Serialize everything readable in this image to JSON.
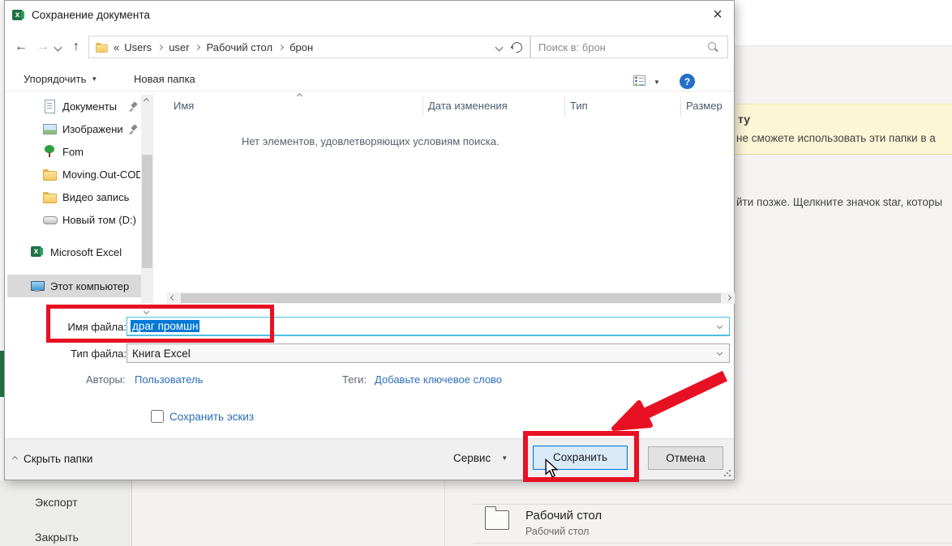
{
  "colors": {
    "annotation_red": "#e81123",
    "accent_blue": "#0078d7",
    "selection_blue": "#0078d7",
    "banner_bg": "#fcf5d6",
    "excel_green": "#217346"
  },
  "dialog": {
    "title": "Сохранение документа",
    "close_glyph": "×",
    "nav": {
      "back_glyph": "←",
      "forward_glyph": "→",
      "up_glyph": "↑",
      "breadcrumb_root": "«",
      "crumbs": [
        "Users",
        "user",
        "Рабочий стол",
        "брон"
      ],
      "search_placeholder": "Поиск в: брон"
    },
    "toolbar": {
      "organize": "Упорядочить",
      "new_folder": "Новая папка",
      "caret_glyph": "▼",
      "help_glyph": "?"
    },
    "sidebar": {
      "items": [
        {
          "label": "Документы",
          "icon": "document",
          "pinned": true,
          "level": 1,
          "selected": false
        },
        {
          "label": "Изображени",
          "icon": "image",
          "pinned": true,
          "level": 1,
          "selected": false
        },
        {
          "label": "Fom",
          "icon": "tree",
          "pinned": false,
          "level": 1,
          "selected": false
        },
        {
          "label": "Moving.Out-COD",
          "icon": "folder",
          "pinned": false,
          "level": 1,
          "selected": false
        },
        {
          "label": "Видео запись",
          "icon": "folder",
          "pinned": false,
          "level": 1,
          "selected": false
        },
        {
          "label": "Новый том (D:)",
          "icon": "drive",
          "pinned": false,
          "level": 1,
          "selected": false
        },
        {
          "label": "Microsoft Excel",
          "icon": "excel",
          "pinned": false,
          "level": 0,
          "selected": false,
          "gap": 1
        },
        {
          "label": "Этот компьютер",
          "icon": "computer",
          "pinned": false,
          "level": 0,
          "selected": true,
          "gap": 2
        }
      ]
    },
    "list": {
      "columns": [
        "Имя",
        "Дата изменения",
        "Тип",
        "Размер"
      ],
      "empty_message": "Нет элементов, удовлетворяющих условиям поиска."
    },
    "fields": {
      "filename_label": "Имя файла:",
      "filename_value": "драг промшн",
      "filetype_label": "Тип файла:",
      "filetype_value": "Книга Excel",
      "authors_label": "Авторы:",
      "authors_value": "Пользователь",
      "tags_label": "Теги:",
      "tags_value": "Добавьте ключевое слово",
      "thumbnail_checkbox_label": "Сохранить эскиз"
    },
    "footer": {
      "hide_folders": "Скрыть папки",
      "tools": "Сервис",
      "tools_caret": "▼",
      "save": "Сохранить",
      "cancel": "Отмена"
    }
  },
  "background": {
    "banner_title_fragment": "ту",
    "banner_text_fragment": "не сможете использовать эти папки в а",
    "note_fragment": "йти позже. Щелкните значок star, которы",
    "menu_items": [
      "Экспорт",
      "Закрыть"
    ],
    "folder_tile": {
      "title": "Рабочий стол",
      "subtitle": "Рабочий стол"
    }
  }
}
